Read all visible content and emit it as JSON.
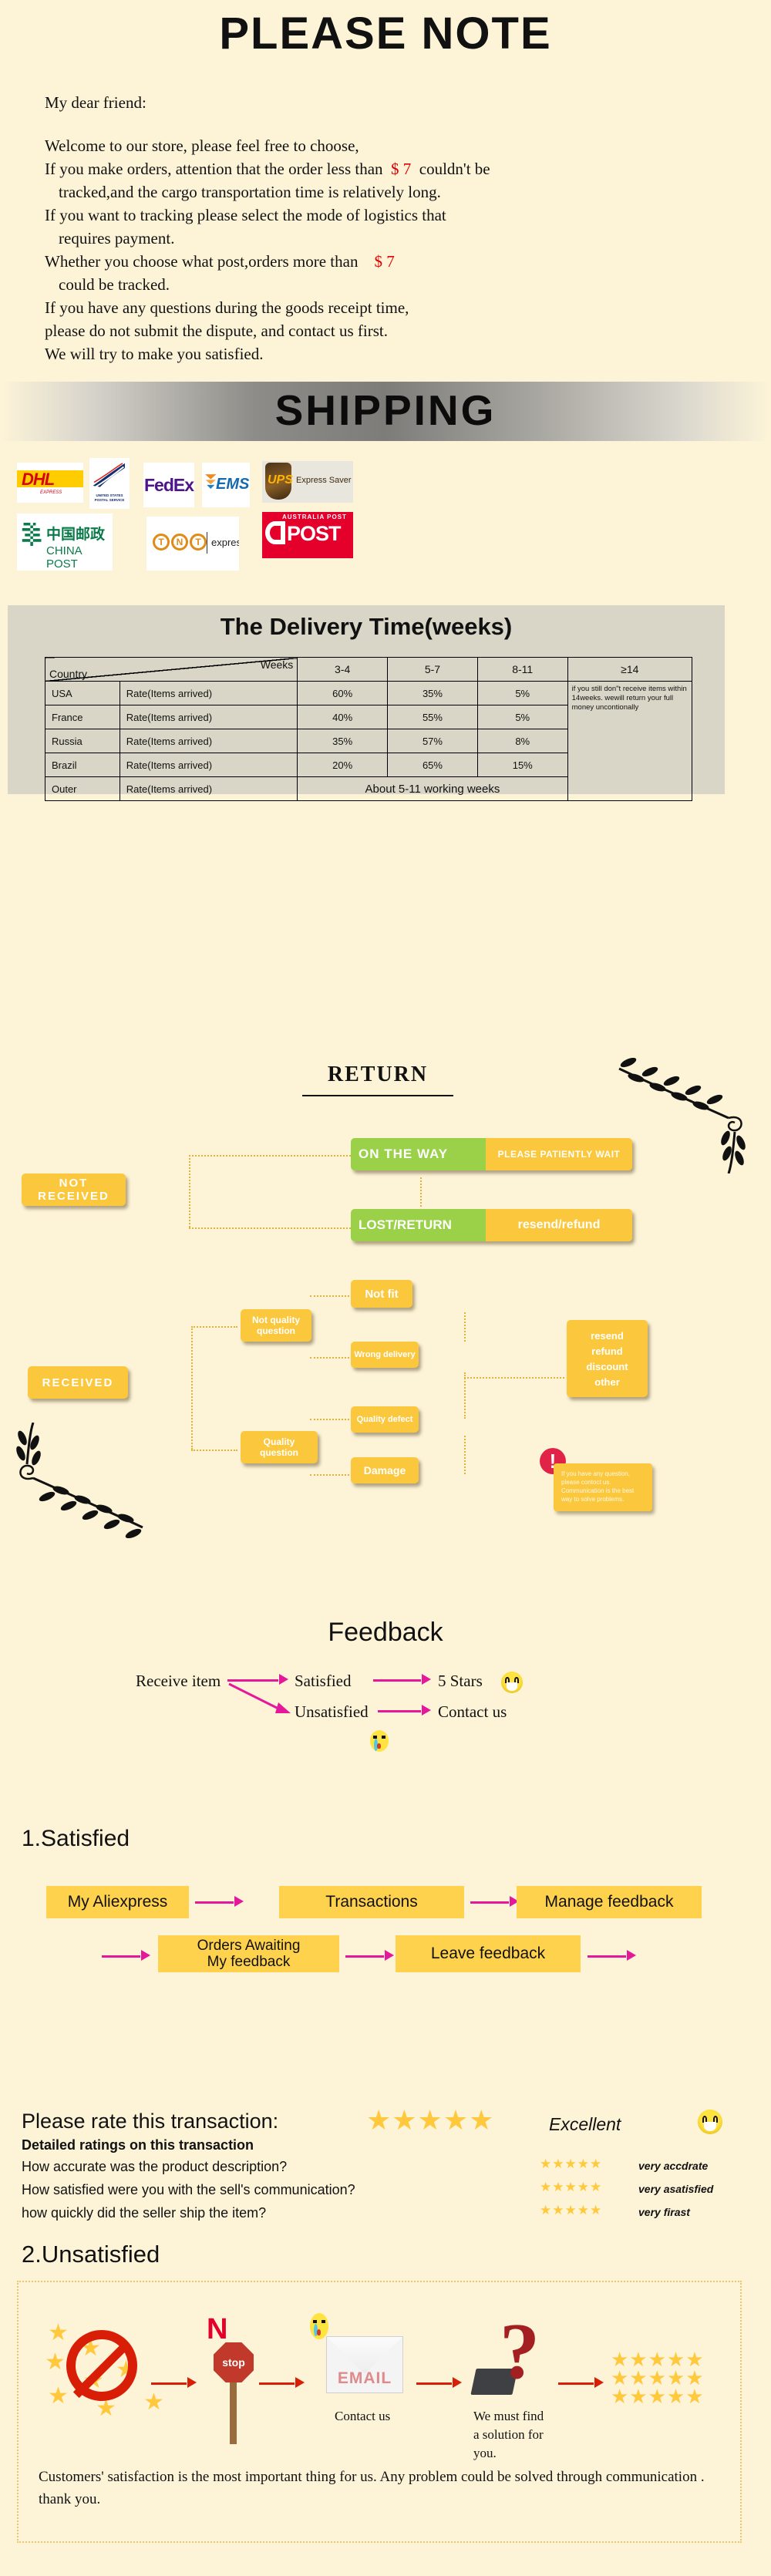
{
  "please_note": {
    "title": "PLEASE NOTE",
    "greeting": "My dear friend:",
    "lines": [
      "Welcome to our store, please feel free to choose,",
      "If you make orders, attention that the order less than",
      "couldn't be",
      "tracked,and the cargo transportation time is relatively long.",
      "If you want to tracking please select the mode of logistics that",
      "requires payment.",
      "Whether you choose what post,orders more than",
      "could be tracked.",
      "If you have any questions during the goods receipt time,",
      "please do not submit the dispute, and contact us first.",
      "We will try to make you satisfied."
    ],
    "price": "$ 7",
    "price_color": "#e00000"
  },
  "shipping": {
    "title": "SHIPPING",
    "carriers": [
      {
        "name": "DHL",
        "sub": "EXPRESS"
      },
      {
        "name": "USPS",
        "sub": "UNITED STATES POSTAL SERVICE"
      },
      {
        "name": "FedEx",
        "sub": ""
      },
      {
        "name": "EMS",
        "sub": ""
      },
      {
        "name": "UPS",
        "sub": "Express Saver"
      },
      {
        "name": "CHINA POST",
        "sub": "中国邮政"
      },
      {
        "name": "TNT",
        "sub": "express"
      },
      {
        "name": "AUSTRALIA POST",
        "sub": "POST"
      }
    ]
  },
  "delivery": {
    "title": "The Delivery Time(weeks)",
    "corner_row_label": "Country",
    "corner_col_label": "Weeks",
    "columns": [
      "3-4",
      "5-7",
      "8-11",
      "≥14"
    ],
    "rate_label": "Rate(Items arrived)",
    "rows": [
      {
        "country": "USA",
        "values": [
          "60%",
          "35%",
          "5%"
        ]
      },
      {
        "country": "France",
        "values": [
          "40%",
          "55%",
          "5%"
        ]
      },
      {
        "country": "Russia",
        "values": [
          "35%",
          "57%",
          "8%"
        ]
      },
      {
        "country": "Brazil",
        "values": [
          "20%",
          "65%",
          "15%"
        ]
      }
    ],
    "outer_row": {
      "country": "Outer",
      "text": "About 5-11 working weeks"
    },
    "side_note": "if you still don\"t receive items within 14weeks. wewill return your full money uncontionally"
  },
  "return_section": {
    "title": "RETURN",
    "not_received": "NOT RECEIVED",
    "received": "RECEIVED",
    "on_the_way": "ON THE WAY",
    "on_the_way_action": "PLEASE PATIENTLY WAIT",
    "lost_return": "LOST/RETURN",
    "lost_return_action": "resend/refund",
    "not_quality_question": "Not quality question",
    "quality_question": "Quality question",
    "not_fit": "Not fit",
    "wrong_delivery": "Wrong delivery",
    "quality_defect": "Quality defect",
    "damage": "Damage",
    "outcomes": [
      "resend",
      "refund",
      "discount",
      "other"
    ],
    "contact_note": "If you have any question, please contoct us. Communication is the best way to solve problems.",
    "alert_glyph": "!",
    "colors": {
      "yellow": "#fbc73d",
      "green": "#9ad149",
      "alert": "#e02346",
      "dotted": "#e3b23c"
    }
  },
  "feedback": {
    "title": "Feedback",
    "receive_item": "Receive item",
    "satisfied": "Satisfied",
    "five_stars": "5 Stars",
    "unsatisfied": "Unsatisfied",
    "contact_us": "Contact us",
    "arrow_color": "#e5189b"
  },
  "satisfied_flow": {
    "heading": "1.Satisfied",
    "row1": [
      "My Aliexpress",
      "Transactions",
      "Manage feedback"
    ],
    "row2": [
      "Orders Awaiting\nMy feedback",
      "Leave feedback"
    ]
  },
  "rating": {
    "prompt": "Please rate this transaction:",
    "stars": "★★★★★",
    "overall_label": "Excellent",
    "detail_heading": "Detailed ratings on this transaction",
    "items": [
      {
        "question": "How accurate was the product description?",
        "stars": "★★★★★",
        "value": "very accdrate"
      },
      {
        "question": "How satisfied were you with the sell's communication?",
        "stars": "★★★★★",
        "value": "very asatisfied"
      },
      {
        "question": "how quickly did the seller ship the item?",
        "stars": "★★★★★",
        "value": "very firast"
      }
    ],
    "star_color": "#ffc83d"
  },
  "unsatisfied_flow": {
    "heading": "2.Unsatisfied",
    "no_label": "N",
    "stop_label": "stop",
    "email_label": "EMAIL",
    "question_glyph": "?",
    "captions": {
      "contact_us": "Contact us",
      "solution": "We must find\na solution for\nyou."
    },
    "bottom_note": "Customers' satisfaction is the most important thing for us. Any problem could be solved through communication . thank you."
  }
}
